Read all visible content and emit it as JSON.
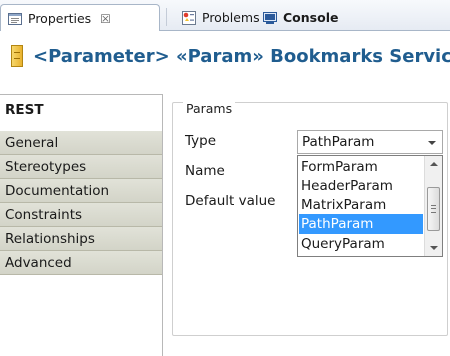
{
  "tabs": [
    {
      "label": "Properties",
      "icon": "properties-icon",
      "close": "☒"
    },
    {
      "label": "Problems",
      "icon": "problems-icon"
    },
    {
      "label": "Console",
      "icon": "console-icon"
    }
  ],
  "title": {
    "text": "<Parameter> «Param» Bookmarks Servic",
    "icon": "parameter-icon"
  },
  "sidebar": {
    "items": [
      {
        "label": "REST"
      },
      {
        "label": "General"
      },
      {
        "label": "Stereotypes"
      },
      {
        "label": "Documentation"
      },
      {
        "label": "Constraints"
      },
      {
        "label": "Relationships"
      },
      {
        "label": "Advanced"
      }
    ],
    "selected": "REST"
  },
  "params": {
    "group_label": "Params",
    "type_label": "Type",
    "name_label": "Name",
    "default_label": "Default value",
    "type_value": "PathParam",
    "options": [
      "FormParam",
      "HeaderParam",
      "MatrixParam",
      "PathParam",
      "QueryParam"
    ],
    "selected_option": "PathParam"
  },
  "colors": {
    "accent": "#205d8f",
    "selection": "#3399ff",
    "sidebar_bg": "#d9dace"
  }
}
